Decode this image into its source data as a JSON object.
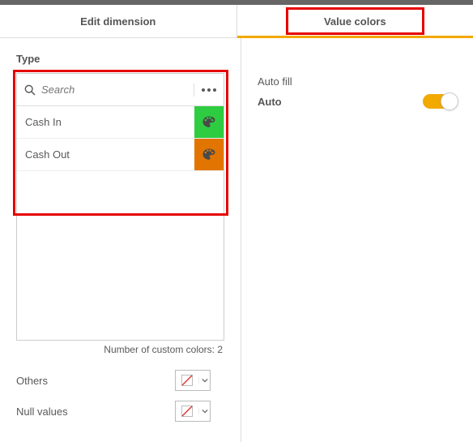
{
  "tabs": {
    "edit_dimension": "Edit dimension",
    "value_colors": "Value colors"
  },
  "left": {
    "type_label": "Type",
    "search_placeholder": "Search",
    "items": [
      {
        "label": "Cash In",
        "color": "#2ecc40"
      },
      {
        "label": "Cash Out",
        "color": "#e27500"
      }
    ],
    "custom_colors_count": "Number of custom colors: 2",
    "others_label": "Others",
    "null_label": "Null values"
  },
  "right": {
    "autofill_label": "Auto fill",
    "auto_text": "Auto",
    "auto_on": true
  }
}
